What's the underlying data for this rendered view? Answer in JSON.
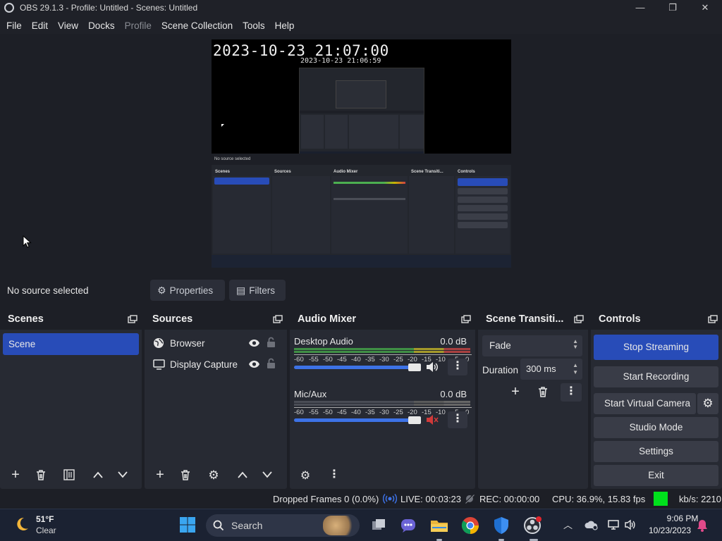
{
  "window": {
    "title": "OBS 29.1.3 - Profile: Untitled - Scenes: Untitled",
    "minimize": "—",
    "maximize": "❐",
    "close": "✕"
  },
  "menu": {
    "items": [
      "File",
      "Edit",
      "View",
      "Docks",
      "Profile",
      "Scene Collection",
      "Tools",
      "Help"
    ],
    "disabled": [
      "Profile"
    ]
  },
  "preview": {
    "timestamp_large": "2023-10-23 21:07:00",
    "timestamp_small": "2023-10-23 21:06:59",
    "nested_no_source": "No source selected",
    "nested_docks": [
      "Scenes",
      "Sources",
      "Audio Mixer",
      "Scene Transiti...",
      "Controls"
    ]
  },
  "source_bar": {
    "no_source": "No source selected",
    "properties": "Properties",
    "filters": "Filters"
  },
  "scenes": {
    "title": "Scenes",
    "items": [
      "Scene"
    ],
    "selected": "Scene"
  },
  "sources": {
    "title": "Sources",
    "items": [
      {
        "label": "Browser",
        "icon": "globe-icon"
      },
      {
        "label": "Display Capture",
        "icon": "monitor-icon"
      }
    ]
  },
  "audio_mixer": {
    "title": "Audio Mixer",
    "scale": [
      "-60",
      "-55",
      "-50",
      "-45",
      "-40",
      "-35",
      "-30",
      "-25",
      "-20",
      "-15",
      "-10",
      "-5",
      "0"
    ],
    "channels": [
      {
        "name": "Desktop Audio",
        "db": "0.0 dB",
        "muted": false,
        "volume": 1.0
      },
      {
        "name": "Mic/Aux",
        "db": "0.0 dB",
        "muted": true,
        "volume": 1.0
      }
    ]
  },
  "transitions": {
    "title": "Scene Transiti...",
    "selected": "Fade",
    "duration_label": "Duration",
    "duration_value": "300 ms"
  },
  "controls": {
    "title": "Controls",
    "stop_streaming": "Stop Streaming",
    "start_recording": "Start Recording",
    "start_virtual_camera": "Start Virtual Camera",
    "studio_mode": "Studio Mode",
    "settings": "Settings",
    "exit": "Exit"
  },
  "status": {
    "dropped_frames": "Dropped Frames 0 (0.0%)",
    "live": "LIVE: 00:03:23",
    "rec": "REC: 00:00:00",
    "cpu": "CPU: 36.9%, 15.83 fps",
    "kbs": "kb/s: 2210",
    "indicator_color": "#00e11c"
  },
  "taskbar": {
    "weather_temp": "51°F",
    "weather_desc": "Clear",
    "search": "Search",
    "time": "9:06 PM",
    "date": "10/23/2023",
    "apps": [
      "file-explorer-icon",
      "teams-chat-icon",
      "folder-icon",
      "chrome-icon",
      "defender-icon",
      "obs-icon"
    ]
  },
  "colors": {
    "accent": "#284cb8",
    "background": "#1d1f26",
    "dock": "#272a33",
    "meter_green": "#4caf50",
    "meter_yellow": "#c8b400",
    "meter_red": "#d04040",
    "mute_red": "#d13a3a"
  }
}
